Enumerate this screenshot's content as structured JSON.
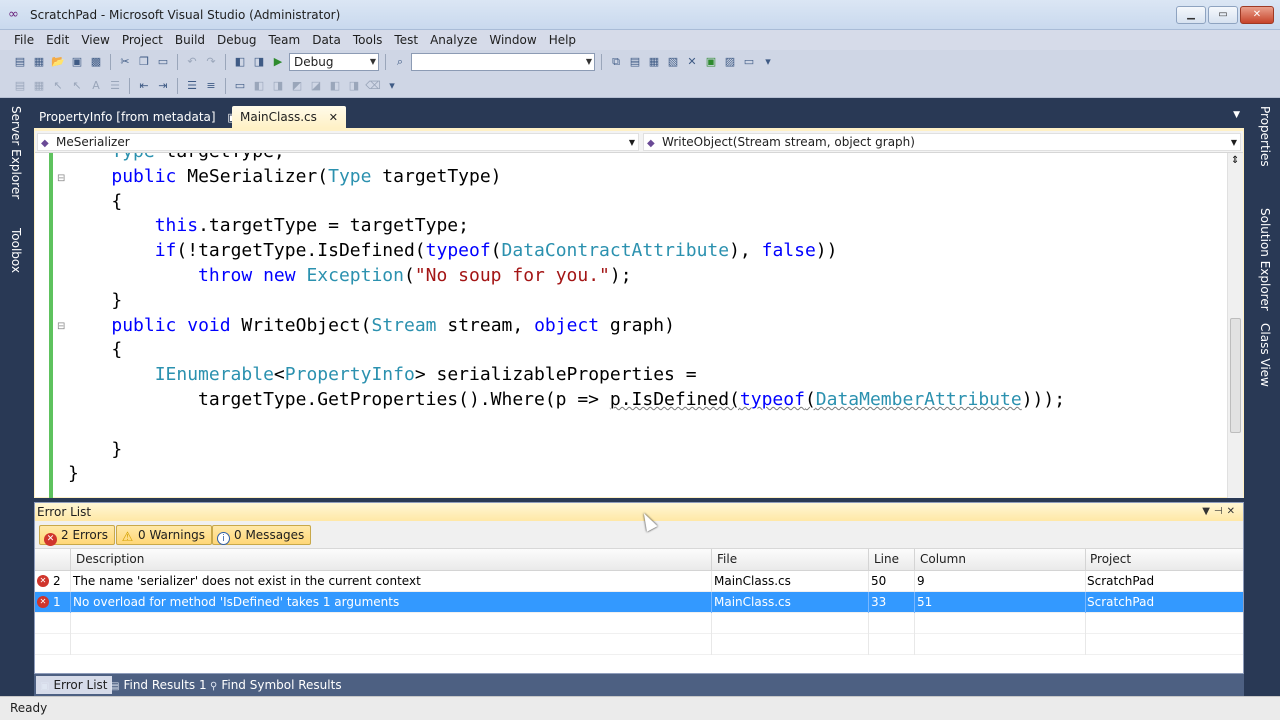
{
  "window": {
    "title": "ScratchPad - Microsoft Visual Studio (Administrator)",
    "icon": "visual-studio-infinity-icon"
  },
  "menu": [
    "File",
    "Edit",
    "View",
    "Project",
    "Build",
    "Debug",
    "Team",
    "Data",
    "Tools",
    "Test",
    "Analyze",
    "Window",
    "Help"
  ],
  "toolbar": {
    "configuration": "Debug",
    "platform": ""
  },
  "side_left": [
    "Server Explorer",
    "Toolbox"
  ],
  "side_right": [
    "Properties",
    "Solution Explorer",
    "Class View"
  ],
  "doc_tabs": [
    {
      "label": "PropertyInfo [from metadata]",
      "active": false
    },
    {
      "label": "MainClass.cs",
      "active": true
    }
  ],
  "nav": {
    "type": "MeSerializer",
    "member": "WriteObject(Stream stream, object graph)"
  },
  "code_lines": [
    {
      "segments": [
        {
          "t": "    "
        },
        {
          "t": "Type",
          "c": "ty"
        },
        {
          "t": " targetType;"
        }
      ]
    },
    {
      "segments": [
        {
          "t": "    "
        },
        {
          "t": "public",
          "c": "kw"
        },
        {
          "t": " MeSerializer("
        },
        {
          "t": "Type",
          "c": "ty"
        },
        {
          "t": " targetType)"
        }
      ]
    },
    {
      "segments": [
        {
          "t": "    {"
        }
      ]
    },
    {
      "segments": [
        {
          "t": "        "
        },
        {
          "t": "this",
          "c": "kw"
        },
        {
          "t": ".targetType = targetType;"
        }
      ]
    },
    {
      "segments": [
        {
          "t": "        "
        },
        {
          "t": "if",
          "c": "kw"
        },
        {
          "t": "(!targetType.IsDefined("
        },
        {
          "t": "typeof",
          "c": "kw"
        },
        {
          "t": "("
        },
        {
          "t": "DataContractAttribute",
          "c": "ty"
        },
        {
          "t": "), "
        },
        {
          "t": "false",
          "c": "kw"
        },
        {
          "t": "))"
        }
      ]
    },
    {
      "segments": [
        {
          "t": "            "
        },
        {
          "t": "throw",
          "c": "kw"
        },
        {
          "t": " "
        },
        {
          "t": "new",
          "c": "kw"
        },
        {
          "t": " "
        },
        {
          "t": "Exception",
          "c": "ty"
        },
        {
          "t": "("
        },
        {
          "t": "\"No soup for you.\"",
          "c": "str"
        },
        {
          "t": ");"
        }
      ]
    },
    {
      "segments": [
        {
          "t": "    }"
        }
      ]
    },
    {
      "segments": [
        {
          "t": "    "
        },
        {
          "t": "public",
          "c": "kw"
        },
        {
          "t": " "
        },
        {
          "t": "void",
          "c": "kw"
        },
        {
          "t": " WriteObject("
        },
        {
          "t": "Stream",
          "c": "ty"
        },
        {
          "t": " stream, "
        },
        {
          "t": "object",
          "c": "kw"
        },
        {
          "t": " graph)"
        }
      ]
    },
    {
      "segments": [
        {
          "t": "    {"
        }
      ]
    },
    {
      "segments": [
        {
          "t": "        "
        },
        {
          "t": "IEnumerable",
          "c": "ty"
        },
        {
          "t": "<"
        },
        {
          "t": "PropertyInfo",
          "c": "ty"
        },
        {
          "t": "> serializableProperties ="
        }
      ]
    },
    {
      "segments": [
        {
          "t": "            targetType.GetProperties().Where(p => "
        },
        {
          "t": "p.IsDefined(",
          "c": "squig"
        },
        {
          "t": "typeof",
          "c": "kw squig"
        },
        {
          "t": "(",
          "c": "squig"
        },
        {
          "t": "DataMemberAttribute",
          "c": "ty squig"
        },
        {
          "t": ")));"
        }
      ]
    },
    {
      "segments": [
        {
          "t": ""
        }
      ]
    },
    {
      "segments": [
        {
          "t": "    }"
        }
      ]
    },
    {
      "segments": [
        {
          "t": "}"
        }
      ]
    }
  ],
  "error_list": {
    "title": "Error List",
    "filters": {
      "errors": "2 Errors",
      "warnings": "0 Warnings",
      "messages": "0 Messages"
    },
    "columns": [
      "Description",
      "File",
      "Line",
      "Column",
      "Project"
    ],
    "rows": [
      {
        "num": "2",
        "description": "The name 'serializer' does not exist in the current context",
        "file": "MainClass.cs",
        "line": "50",
        "column": "9",
        "project": "ScratchPad",
        "selected": false
      },
      {
        "num": "1",
        "description": "No overload for method 'IsDefined' takes 1 arguments",
        "file": "MainClass.cs",
        "line": "33",
        "column": "51",
        "project": "ScratchPad",
        "selected": true
      }
    ]
  },
  "bottom_tabs": [
    "Error List",
    "Find Results 1",
    "Find Symbol Results"
  ],
  "status": "Ready"
}
